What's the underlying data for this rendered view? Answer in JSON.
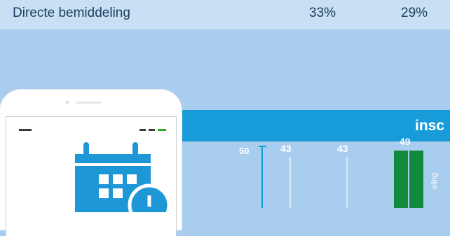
{
  "table_row": {
    "label": "Directe bemiddeling",
    "value_1": "33%",
    "value_2": "29%"
  },
  "banner": {
    "title": "insc"
  },
  "chart_data": {
    "type": "bar",
    "y_tick_visible": [
      "50"
    ],
    "data_labels": [
      "43",
      "43",
      "49"
    ],
    "values": [
      43,
      43,
      49
    ],
    "bar_colors": [
      "#ffffff",
      "#ffffff",
      "#128a3c"
    ],
    "vertical_label_fragment": "eling"
  },
  "colors": {
    "background": "#a9cdee",
    "table_row": "#c9dff3",
    "banner": "#189cd9",
    "calendar_icon": "#1e97d7",
    "bar_green": "#128a3c"
  },
  "icons": [
    "calendar-icon",
    "phone-icon"
  ]
}
